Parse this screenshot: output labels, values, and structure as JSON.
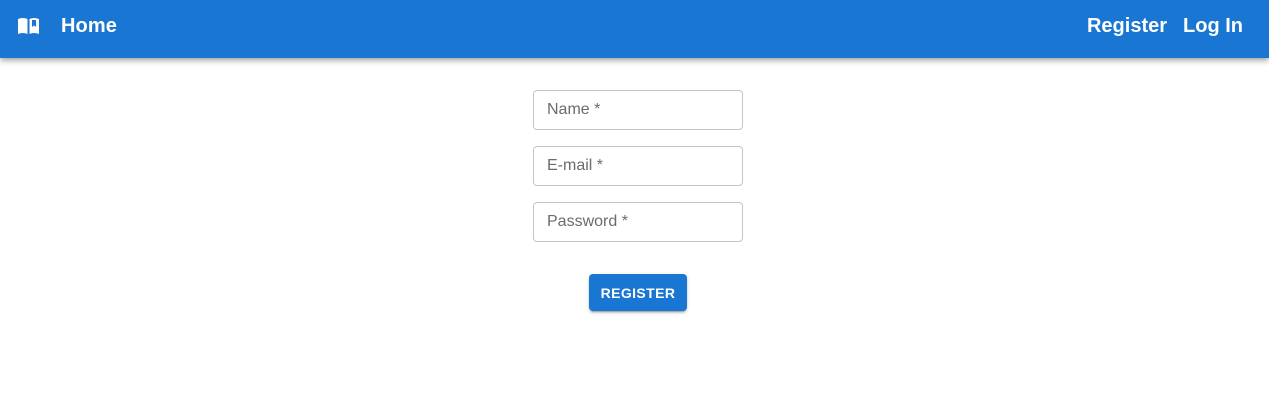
{
  "header": {
    "brand_icon": "book-open-icon",
    "home_label": "Home",
    "nav": {
      "register_label": "Register",
      "login_label": "Log In"
    },
    "background_color": "#1976d2"
  },
  "form": {
    "name_field": {
      "placeholder": "Name *",
      "value": ""
    },
    "email_field": {
      "placeholder": "E-mail *",
      "value": ""
    },
    "password_field": {
      "placeholder": "Password *",
      "value": ""
    },
    "submit_label": "REGISTER",
    "submit_color": "#1976d2"
  }
}
